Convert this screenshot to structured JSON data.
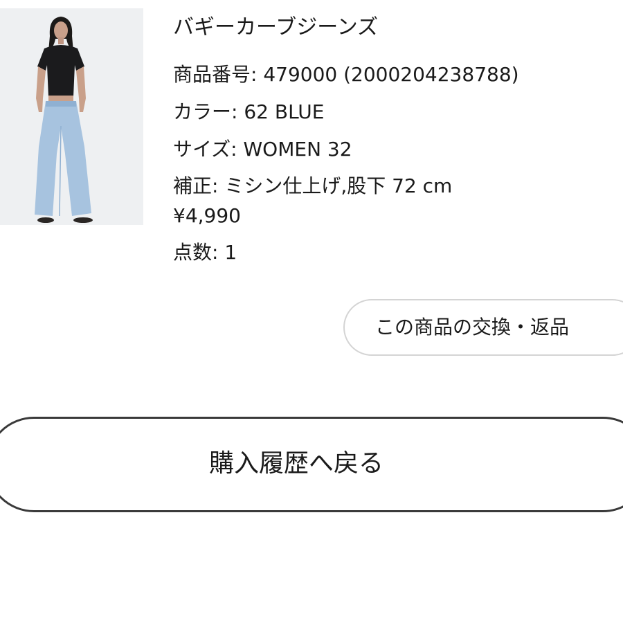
{
  "product": {
    "image_icon": "model-photo",
    "title": "バギーカーブジーンズ",
    "number": "商品番号: 479000 (2000204238788)",
    "color": "カラー: 62 BLUE",
    "size": "サイズ: WOMEN 32",
    "alteration": "補正: ミシン仕上げ,股下 72 cm",
    "price": "¥4,990",
    "quantity": "点数: 1"
  },
  "actions": {
    "exchange_return_label": "この商品の交換・返品",
    "back_to_history_label": "購入履歴へ戻る"
  }
}
